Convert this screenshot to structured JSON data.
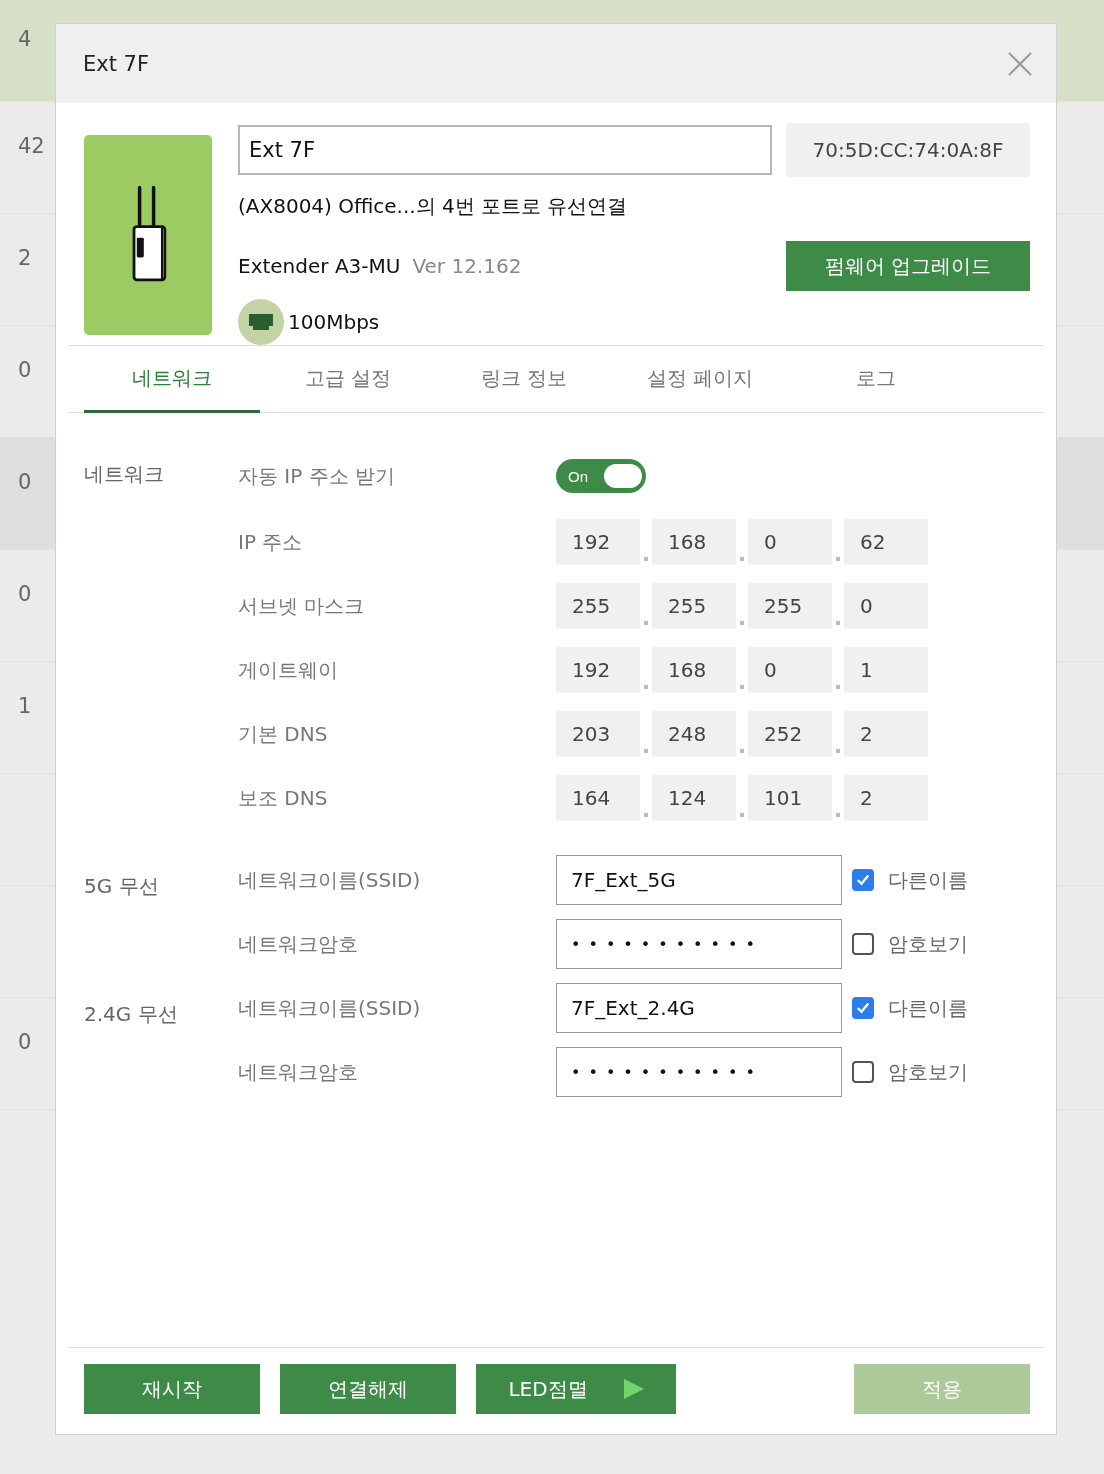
{
  "background_list": {
    "rows": [
      {
        "count": "4",
        "selected": true,
        "hovered": false
      },
      {
        "count": "42",
        "selected": false,
        "hovered": false
      },
      {
        "count": "2",
        "selected": false,
        "hovered": false
      },
      {
        "count": "0",
        "selected": false,
        "hovered": false
      },
      {
        "count": "0",
        "selected": false,
        "hovered": true
      },
      {
        "count": "0",
        "selected": false,
        "hovered": false
      },
      {
        "count": "1",
        "selected": false,
        "hovered": false
      },
      {
        "selected": false,
        "hovered": false
      },
      {
        "selected": false,
        "hovered": false
      },
      {
        "count": "0",
        "selected": false,
        "hovered": false
      }
    ]
  },
  "dialog": {
    "title": "Ext 7F",
    "device": {
      "name_value": "Ext 7F",
      "mac": "70:5D:CC:74:0A:8F",
      "connection": "(AX8004) Office...의 4번 포트로 유선연결",
      "model": "Extender A3-MU",
      "version": "Ver 12.162",
      "firmware_button": "펌웨어 업그레이드",
      "link_speed": "100Mbps"
    },
    "tabs": [
      {
        "label": "네트워크",
        "selected": true
      },
      {
        "label": "고급 설정",
        "selected": false
      },
      {
        "label": "링크 정보",
        "selected": false
      },
      {
        "label": "설정 페이지",
        "selected": false
      },
      {
        "label": "로그",
        "selected": false
      }
    ],
    "network": {
      "section_label": "네트워크",
      "auto_ip": {
        "label": "자동 IP 주소 받기",
        "toggle_text": "On",
        "on": true
      },
      "addresses": [
        {
          "label": "IP 주소",
          "octets": [
            "192",
            "168",
            "0",
            "62"
          ]
        },
        {
          "label": "서브넷 마스크",
          "octets": [
            "255",
            "255",
            "255",
            "0"
          ]
        },
        {
          "label": "게이트웨이",
          "octets": [
            "192",
            "168",
            "0",
            "1"
          ]
        },
        {
          "label": "기본 DNS",
          "octets": [
            "203",
            "248",
            "252",
            "2"
          ]
        },
        {
          "label": "보조 DNS",
          "octets": [
            "164",
            "124",
            "101",
            "2"
          ]
        }
      ]
    },
    "wireless": [
      {
        "section_label": "5G 무선",
        "ssid": {
          "label": "네트워크이름(SSID)",
          "value": "7F_Ext_5G",
          "checkbox_label": "다른이름",
          "checked": true
        },
        "password": {
          "label": "네트워크암호",
          "value": "•••••••••••",
          "checkbox_label": "암호보기",
          "checked": false
        }
      },
      {
        "section_label": "2.4G 무선",
        "ssid": {
          "label": "네트워크이름(SSID)",
          "value": "7F_Ext_2.4G",
          "checkbox_label": "다른이름",
          "checked": true
        },
        "password": {
          "label": "네트워크암호",
          "value": "•••••••••••",
          "checkbox_label": "암호보기",
          "checked": false
        }
      }
    ],
    "buttons": [
      {
        "label": "재시작",
        "kind": "plain",
        "disabled": false
      },
      {
        "label": "연결해제",
        "kind": "plain",
        "disabled": false
      },
      {
        "label": "LED점멸",
        "kind": "play",
        "disabled": false
      },
      {
        "label": "적용",
        "kind": "apply",
        "disabled": true
      }
    ]
  }
}
